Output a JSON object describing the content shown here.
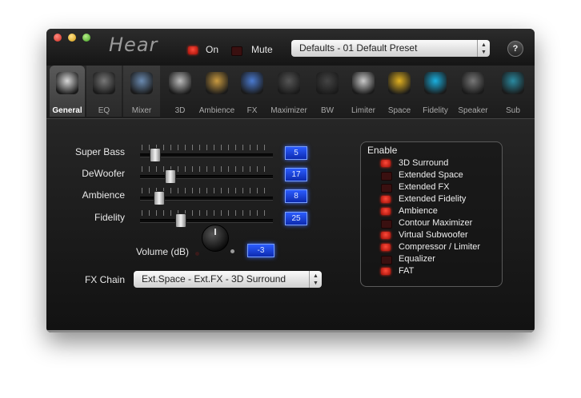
{
  "app": {
    "title": "Hear"
  },
  "toolbar": {
    "on_label": "On",
    "mute_label": "Mute",
    "preset_value": "Defaults - 01 Default Preset",
    "help_label": "?"
  },
  "tabs": [
    {
      "label": "General",
      "icon": "speaker-box-icon",
      "active": true
    },
    {
      "label": "EQ",
      "icon": "equalizer-sliders-icon"
    },
    {
      "label": "Mixer",
      "icon": "mixer-bars-icon"
    },
    {
      "label": "3D",
      "icon": "surround-speakers-icon"
    },
    {
      "label": "Ambience",
      "icon": "speaker-cone-icon"
    },
    {
      "label": "FX",
      "icon": "stage-lights-icon"
    },
    {
      "label": "Maximizer",
      "icon": "headphones-icon"
    },
    {
      "label": "BW",
      "icon": "joystick-icon"
    },
    {
      "label": "Limiter",
      "icon": "meter-gauge-icon"
    },
    {
      "label": "Space",
      "icon": "light-beam-icon"
    },
    {
      "label": "Fidelity",
      "icon": "glowing-orb-icon"
    },
    {
      "label": "Speaker",
      "icon": "speaker-disc-icon"
    },
    {
      "label": "Sub",
      "icon": "subwoofer-wave-icon"
    }
  ],
  "sliders": [
    {
      "label": "Super Bass",
      "value": "5",
      "level": 0.05
    },
    {
      "label": "DeWoofer",
      "value": "17",
      "level": 0.17
    },
    {
      "label": "Ambience",
      "value": "8",
      "level": 0.08
    },
    {
      "label": "Fidelity",
      "value": "25",
      "level": 0.25
    }
  ],
  "volume": {
    "label": "Volume (dB)",
    "value": "-3"
  },
  "fx_chain": {
    "label": "FX Chain",
    "value": "Ext.Space - Ext.FX - 3D Surround"
  },
  "enable": {
    "title": "Enable",
    "items": [
      {
        "label": "3D Surround",
        "on": true
      },
      {
        "label": "Extended Space",
        "on": false
      },
      {
        "label": "Extended FX",
        "on": false
      },
      {
        "label": "Extended Fidelity",
        "on": true
      },
      {
        "label": "Ambience",
        "on": true
      },
      {
        "label": "Contour Maximizer",
        "on": false
      },
      {
        "label": "Virtual Subwoofer",
        "on": true
      },
      {
        "label": "Compressor / Limiter",
        "on": true
      },
      {
        "label": "Equalizer",
        "on": false
      },
      {
        "label": "FAT",
        "on": true
      }
    ]
  },
  "colors": {
    "led_on": "#e0231a",
    "led_off": "#3a1010",
    "value_box": "#1f45e0"
  }
}
